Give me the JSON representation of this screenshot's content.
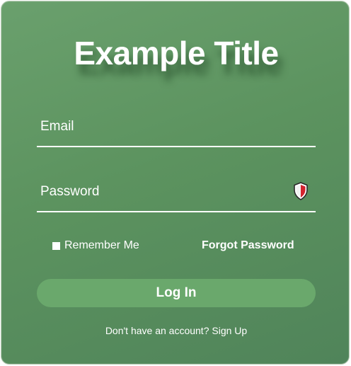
{
  "colors": {
    "card_background": "#5c935f",
    "button_background": "#6aa86c",
    "text": "#ffffff",
    "underline": "#ffffff"
  },
  "login_form": {
    "title": "Example Title",
    "email": {
      "placeholder": "Email",
      "value": ""
    },
    "password": {
      "placeholder": "Password",
      "value": "",
      "icon": "shield-icon"
    },
    "remember_me": {
      "label": "Remember Me",
      "checked": true
    },
    "forgot_password_label": "Forgot Password",
    "login_button_label": "Log In",
    "signup_prompt": "Don't have an account?",
    "signup_link_label": "Sign Up"
  }
}
